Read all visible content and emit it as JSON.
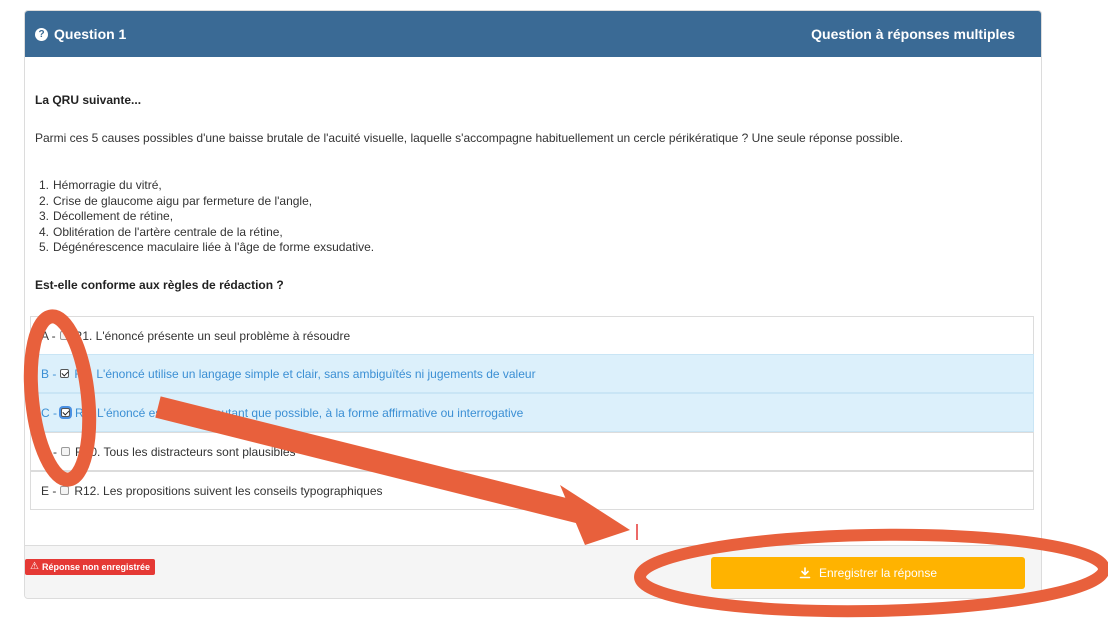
{
  "header": {
    "question_label": "Question 1",
    "question_type": "Question à réponses multiples",
    "help_icon": "question-circle-icon"
  },
  "question": {
    "intro": "La QRU suivante...",
    "stem": "Parmi ces 5 causes possibles d'une baisse brutale de l'acuité visuelle, laquelle s'accompagne habituellement un cercle périkératique ? Une seule réponse possible.",
    "items": [
      {
        "num": "1.",
        "text": "Hémorragie du vitré,"
      },
      {
        "num": "2.",
        "text": "Crise de glaucome aigu par fermeture de l'angle,"
      },
      {
        "num": "3.",
        "text": "Décollement de rétine,"
      },
      {
        "num": "4.",
        "text": "Oblitération de l'artère centrale de la rétine,"
      },
      {
        "num": "5.",
        "text": "Dégénérescence maculaire liée à l'âge de forme exsudative."
      }
    ],
    "subquestion": "Est-elle conforme aux règles de rédaction ?"
  },
  "options": [
    {
      "letter": "A -",
      "text": "R1. L'énoncé présente un seul problème à résoudre",
      "checked": false
    },
    {
      "letter": "B -",
      "text": "R4. L'énoncé utilise un langage simple et clair, sans ambiguïtés ni jugements de valeur",
      "checked": true
    },
    {
      "letter": "C -",
      "text": "R5. L'énoncé est formulé, autant que possible, à la forme affirmative ou interrogative",
      "checked": true
    },
    {
      "letter": "D -",
      "text": "R10. Tous les distracteurs sont plausibles",
      "checked": false
    },
    {
      "letter": "E -",
      "text": "R12. Les propositions suivent les conseils typographiques",
      "checked": false
    }
  ],
  "footer": {
    "status_badge": "Réponse non enregistrée",
    "save_label": "Enregistrer la réponse",
    "warning_icon": "warning-triangle-icon",
    "download_icon": "download-icon"
  },
  "colors": {
    "header_bg": "#3a6a95",
    "checked_row_bg": "#dcf0fb",
    "checked_text": "#3b8fd4",
    "badge_bg": "#e53935",
    "save_bg": "#ffb300",
    "annotation": "#e8603c"
  }
}
